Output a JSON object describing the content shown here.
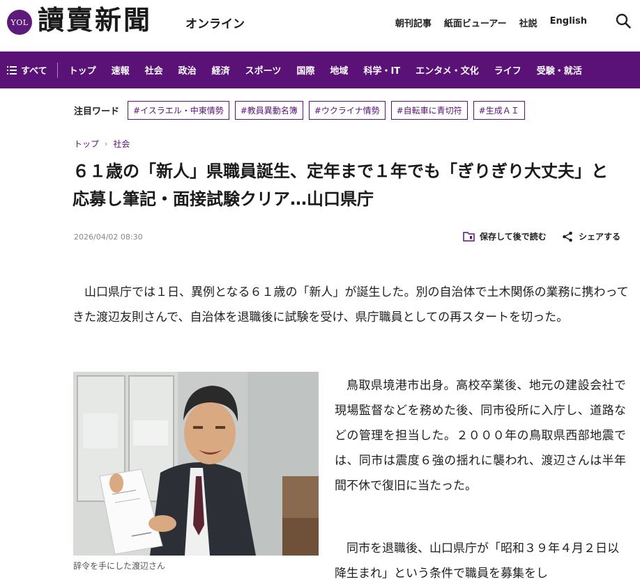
{
  "header": {
    "logo_badge": "YOL",
    "logo": "讀賣新聞",
    "logo_sub": "オンライン",
    "links": [
      "朝刊記事",
      "紙面ビューアー",
      "社説",
      "English"
    ]
  },
  "nav": {
    "all_label": "すべて",
    "items": [
      "トップ",
      "速報",
      "社会",
      "政治",
      "経済",
      "スポーツ",
      "国際",
      "地域",
      "科学・IT",
      "エンタメ・文化",
      "ライフ",
      "受験・就活"
    ]
  },
  "trending": {
    "label": "注目ワード",
    "tags": [
      "#イスラエル・中東情勢",
      "#教員異動名簿",
      "#ウクライナ情勢",
      "#自転車に青切符",
      "#生成ＡＩ"
    ]
  },
  "breadcrumb": [
    "トップ",
    "社会"
  ],
  "article": {
    "title": "６１歳の「新人」県職員誕生、定年まで１年でも「ぎりぎり大丈夫」と応募し筆記・面接試験クリア…山口県庁",
    "date": "2026/04/02 08:30",
    "save_label": "保存して後で読む",
    "share_label": "シェアする",
    "lead": "山口県庁では１日、異例となる６１歳の「新人」が誕生した。別の自治体で土木関係の業務に携わってきた渡辺友則さんで、自治体を退職後に試験を受け、県庁職員としての再スタートを切った。",
    "caption": "辞令を手にした渡辺さん",
    "para2": "鳥取県境港市出身。高校卒業後、地元の建設会社で現場監督などを務めた後、同市役所に入庁し、道路などの管理を担当した。２０００年の鳥取県西部地震では、同市は震度６強の揺れに襲われ、渡辺さんは半年間不休で復旧に当たった。",
    "para3": "同市を退職後、山口県庁が「昭和３９年４月２日以降生まれ」という条件で職員を募集をし"
  },
  "colors": {
    "brand_purple": "#5a1277",
    "text": "#1e1e1e",
    "muted": "#888888"
  }
}
